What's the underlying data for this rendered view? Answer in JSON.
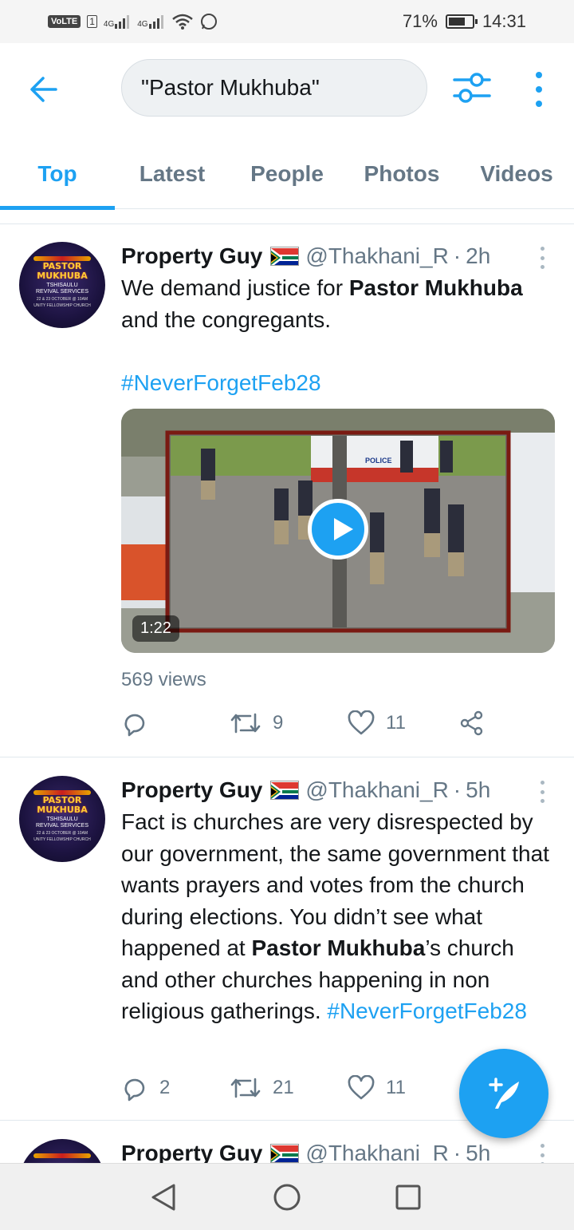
{
  "status_bar": {
    "network": "VoLTE",
    "sim_slot": "1",
    "signal_1": "4G",
    "signal_2": "4G",
    "battery_percent": "71%",
    "battery_level": 0.71,
    "time": "14:31"
  },
  "header": {
    "search_query": "\"Pastor Mukhuba\""
  },
  "tabs": [
    {
      "label": "Top",
      "active": true
    },
    {
      "label": "Latest",
      "active": false
    },
    {
      "label": "People",
      "active": false
    },
    {
      "label": "Photos",
      "active": false
    },
    {
      "label": "Videos",
      "active": false
    }
  ],
  "avatar": {
    "title_line1": "PASTOR",
    "title_line2": "MUKHUBA",
    "subtitle_line1": "TSHISAULU",
    "subtitle_line2": "REVIVAL SERVICES",
    "date_line": "22 & 23 OCTOBER @ 10AM",
    "church_line": "UNITY FELLOWSHIP CHURCH"
  },
  "tweets": [
    {
      "name": "Property Guy",
      "handle": "@Thakhani_R",
      "separator": "·",
      "time": "2h",
      "text_part1": "We demand justice for ",
      "text_bold1": "Pastor Mukhuba",
      "text_part2": " and the congregants.",
      "hashtag": "#NeverForgetFeb28",
      "video_duration": "1:22",
      "police_label": "POLICE",
      "views": "569 views",
      "replies": "",
      "retweets": "9",
      "likes": "11"
    },
    {
      "name": "Property Guy",
      "handle": "@Thakhani_R",
      "separator": "·",
      "time": "5h",
      "text_part1": "Fact is churches are very disrespected by our government, the same government that wants prayers and votes from the church during elections. You didn’t see what happened at ",
      "text_bold1": "Pastor Mukhuba",
      "text_part2": "’s church and other churches happening in non religious gatherings. ",
      "hashtag": "#NeverForgetFeb28",
      "replies": "2",
      "retweets": "21",
      "likes": "11"
    },
    {
      "name": "Property Guy",
      "handle": "@Thakhani_R",
      "separator": "·",
      "time": "5h"
    }
  ],
  "colors": {
    "accent": "#1da1f2",
    "text_primary": "#14171a",
    "text_secondary": "#657786"
  },
  "icons": {
    "back": "arrow-left-icon",
    "filter": "sliders-icon",
    "more": "more-vertical-icon",
    "reply": "reply-icon",
    "retweet": "retweet-icon",
    "like": "heart-icon",
    "share": "share-icon",
    "compose": "compose-tweet-icon"
  }
}
